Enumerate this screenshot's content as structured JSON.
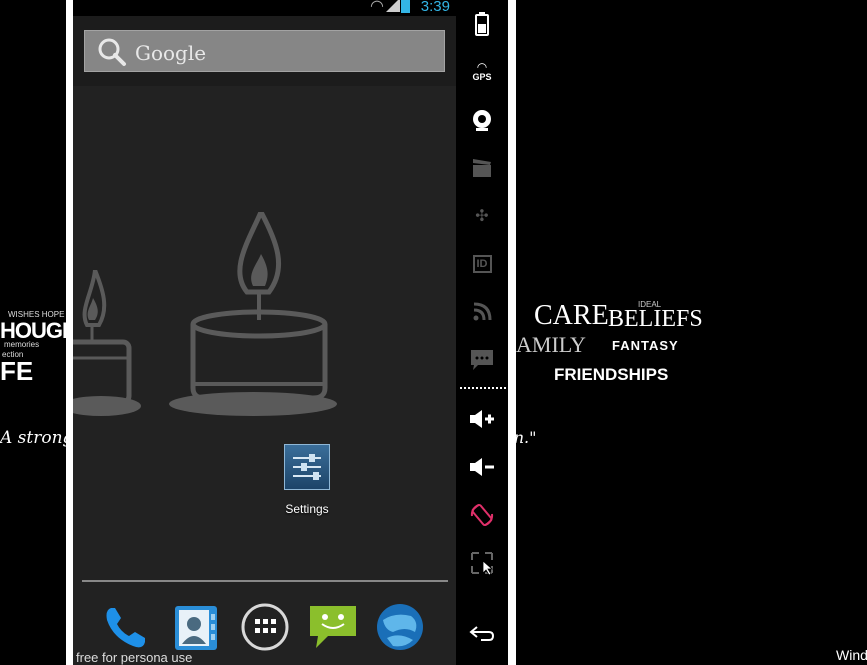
{
  "status_bar": {
    "time": "3:39"
  },
  "search": {
    "label": "Google"
  },
  "apps": {
    "settings_label": "Settings"
  },
  "watermark": "free for persona  use",
  "emulator_panel": {
    "gps_label": "GPS",
    "id_label": "ID"
  },
  "background": {
    "left_words_top": "HOUGH",
    "left_words_bottom": "FE",
    "quote_left": "A strong",
    "right_care": "CARE",
    "right_beliefs": "BELIEFS",
    "right_fantasy": "FANTASY",
    "right_friendships": "FRIENDSHIPS",
    "right_family": "AMILY",
    "right_ideal": "IDEAL",
    "quote_right": "wn.\"",
    "taskbar_text": "Wind"
  },
  "colors": {
    "status_accent": "#33b5e5",
    "screen_bg": "#222222",
    "searchbar_bg": "#868686",
    "candle_color": "#5a5a5a",
    "rotate_icon": "#e0306a"
  },
  "icons": [
    "search-icon",
    "phone-icon",
    "contacts-icon",
    "all-apps-icon",
    "messaging-icon",
    "browser-icon",
    "battery-icon",
    "gps-icon",
    "camera-icon",
    "video-icon",
    "dpad-icon",
    "id-icon",
    "rss-icon",
    "sms-icon",
    "volume-up-icon",
    "volume-down-icon",
    "rotate-icon",
    "fullscreen-icon",
    "back-icon"
  ]
}
